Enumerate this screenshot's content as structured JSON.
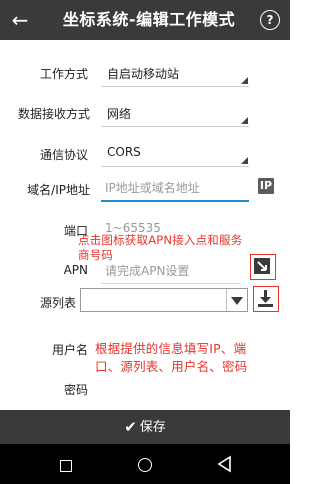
{
  "header": {
    "back_icon": "←",
    "title": "坐标系统-编辑工作模式",
    "help_icon": "?"
  },
  "form": {
    "work_mode": {
      "label": "工作方式",
      "value": "自启动移动站"
    },
    "data_receive": {
      "label": "数据接收方式",
      "value": "网络"
    },
    "protocol": {
      "label": "通信协议",
      "value": "CORS"
    },
    "domain": {
      "label": "域名/IP地址",
      "placeholder": "IP地址或域名地址",
      "ip_button": "IP"
    },
    "port": {
      "label": "端口",
      "placeholder": "1~65535"
    },
    "apn": {
      "label": "APN",
      "placeholder": "请完成APN设置"
    },
    "source_table": {
      "label": "源列表",
      "value": ""
    },
    "username": {
      "label": "用户名"
    },
    "password": {
      "label": "密码"
    }
  },
  "annotations": {
    "apn_hint_line1": "点击图标获取APN接入点和服务",
    "apn_hint_line2": "商号码",
    "fill_hint_line1": "根据提供的信息填写IP、端",
    "fill_hint_line2": "口、源列表、用户名、密码"
  },
  "footer": {
    "save_icon": "✔",
    "save_label": "保存"
  },
  "colors": {
    "header_bg": "#3a3a3a",
    "accent_blue": "#1e8ad6",
    "annotation_red": "#e8342c"
  }
}
